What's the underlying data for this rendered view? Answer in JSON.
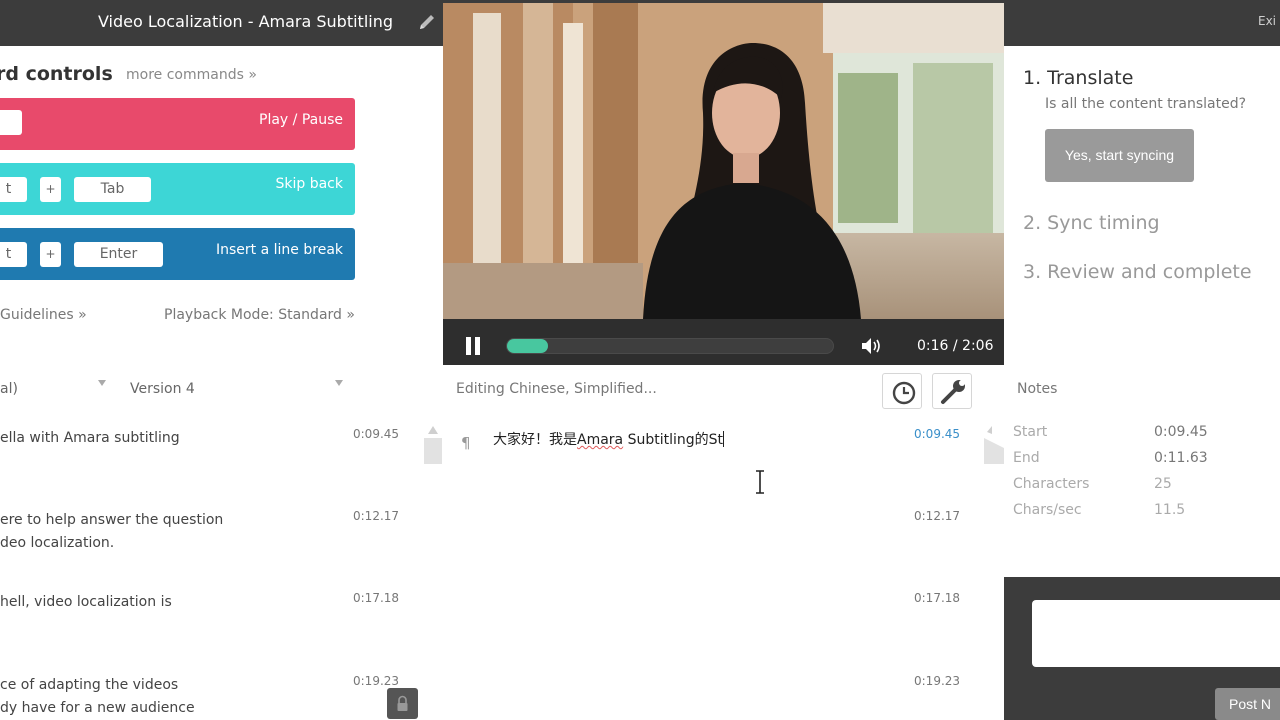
{
  "header": {
    "title": "Video Localization - Amara Subtitling",
    "exit_label": "Exi"
  },
  "keyboard": {
    "title": "rd controls",
    "more_commands": "more commands »",
    "shortcuts": [
      {
        "action": "Play / Pause",
        "keys": [
          ""
        ],
        "color": "#e84a6b"
      },
      {
        "action": "Skip back",
        "keys": [
          "t",
          "+",
          "Tab"
        ],
        "color": "#3dd6d6"
      },
      {
        "action": "Insert a line break",
        "keys": [
          "t",
          "+",
          "Enter"
        ],
        "color": "#1f7ab0"
      }
    ]
  },
  "links": {
    "guidelines": "Guidelines »",
    "playback_mode": "Playback Mode: Standard »"
  },
  "columns": {
    "original": "al)",
    "version": "Version 4"
  },
  "original_subtitles": [
    {
      "lines": [
        "ella with Amara subtitling"
      ],
      "time": "0:09.45"
    },
    {
      "lines": [
        "ere to help answer the question",
        "deo localization."
      ],
      "time": "0:12.17"
    },
    {
      "lines": [
        "hell, video localization is"
      ],
      "time": "0:17.18"
    },
    {
      "lines": [
        "ce of adapting the videos",
        "dy have for a new audience"
      ],
      "time": "0:19.23"
    }
  ],
  "player": {
    "time_display": "0:16 / 2:06",
    "progress_fraction": 0.125
  },
  "editor": {
    "label": "Editing Chinese, Simplified...",
    "pilcrow": "¶",
    "text_before": "大家好！我是",
    "text_misspelled": "Amara",
    "text_after": " Subtitling的St",
    "translation_times": [
      "0:09.45",
      "0:12.17",
      "0:17.18",
      "0:19.23"
    ]
  },
  "workflow": {
    "step1": "1. Translate",
    "step1_question": "Is all the content translated?",
    "step1_button": "Yes, start syncing",
    "step2": "2. Sync timing",
    "step3": "3. Review and complete"
  },
  "notes": {
    "label": "Notes",
    "post_button": "Post N"
  },
  "stats": [
    {
      "label": "Start",
      "value": "0:09.45"
    },
    {
      "label": "End",
      "value": "0:11.63"
    },
    {
      "label": "Characters",
      "value": "25"
    },
    {
      "label": "Chars/sec",
      "value": "11.5"
    }
  ],
  "colors": {
    "accent_blue": "#1f7ab0",
    "progress_green": "#48c79f"
  }
}
